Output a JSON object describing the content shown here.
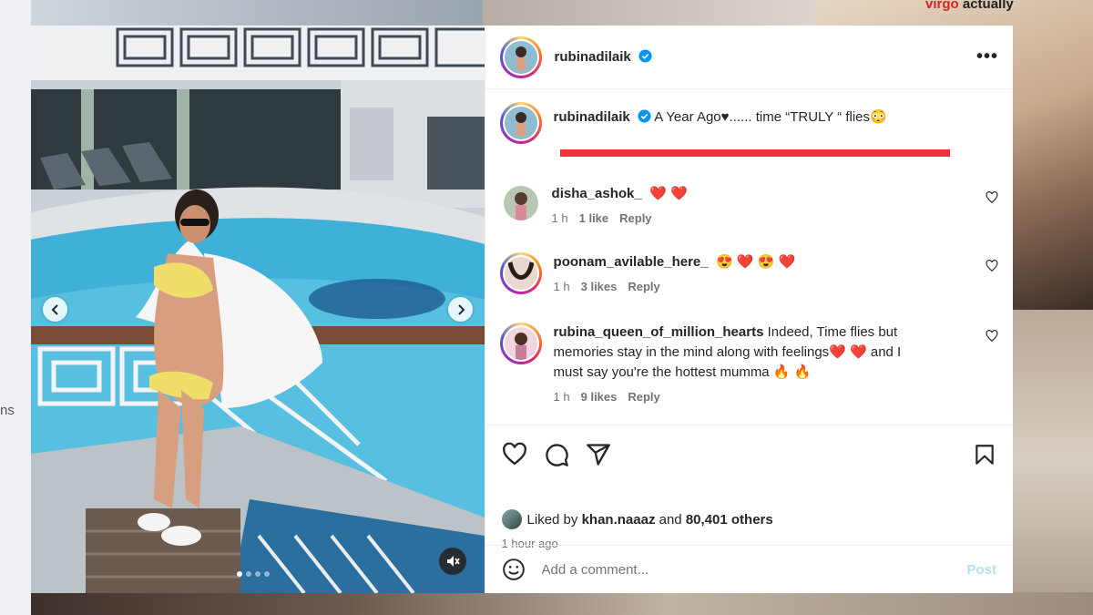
{
  "background": {
    "top_right_text_1": "virgo",
    "top_right_text_2": "actually",
    "left_fragment": "ns"
  },
  "post": {
    "author": "rubinadilaik",
    "more_label": "•••",
    "caption_text": "A Year Ago♥...... time “TRULY “ flies😳",
    "media": {
      "carousel_dots": 4,
      "active_dot": 0
    }
  },
  "comments": [
    {
      "username": "disha_ashok_",
      "text": "❤️ ❤️",
      "time": "1 h",
      "likes": "1 like",
      "reply": "Reply"
    },
    {
      "username": "poonam_avilable_here_",
      "text": "😍 ❤️ 😍 ❤️",
      "time": "1 h",
      "likes": "3 likes",
      "reply": "Reply"
    },
    {
      "username": "rubina_queen_of_million_hearts",
      "text_line1": "Indeed, Time flies but",
      "text_line2": "memories stay in the mind along with feelings❤️ ❤️  and I",
      "text_line3": "must say you're the hottest mumma 🔥 🔥",
      "time": "1 h",
      "likes": "9 likes",
      "reply": "Reply"
    }
  ],
  "liked_by": {
    "prefix": "Liked by",
    "user": "khan.naaaz",
    "and": "and",
    "others": "80,401 others"
  },
  "timestamp": "1 hour ago",
  "comment_box": {
    "placeholder": "Add a comment...",
    "post_label": "Post"
  },
  "colors": {
    "highlight_bar": "#f0313a",
    "verified": "#0095f6",
    "post_button_disabled": "#b2dffc"
  }
}
